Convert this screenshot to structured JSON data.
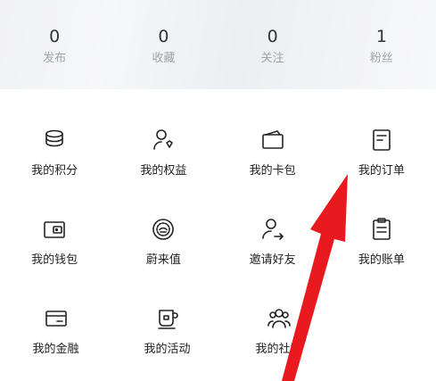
{
  "stats": [
    {
      "value": "0",
      "label": "发布"
    },
    {
      "value": "0",
      "label": "收藏"
    },
    {
      "value": "0",
      "label": "关注"
    },
    {
      "value": "1",
      "label": "粉丝"
    }
  ],
  "menu": {
    "rows": [
      [
        {
          "label": "我的积分",
          "icon": "coins-stack-icon"
        },
        {
          "label": "我的权益",
          "icon": "user-badge-icon"
        },
        {
          "label": "我的卡包",
          "icon": "wallet-card-icon"
        },
        {
          "label": "我的订单",
          "icon": "order-document-icon"
        }
      ],
      [
        {
          "label": "我的钱包",
          "icon": "wallet-icon"
        },
        {
          "label": "蔚来值",
          "icon": "nio-value-badge-icon"
        },
        {
          "label": "邀请好友",
          "icon": "invite-user-icon"
        },
        {
          "label": "我的账单",
          "icon": "bill-clipboard-icon"
        }
      ],
      [
        {
          "label": "我的金融",
          "icon": "finance-card-icon"
        },
        {
          "label": "我的活动",
          "icon": "activity-cup-icon"
        },
        {
          "label": "我的社群",
          "icon": "community-users-icon"
        }
      ]
    ]
  },
  "overlay": {
    "icon": "red-arrow-pointer-icon",
    "color": "#e8191f"
  }
}
